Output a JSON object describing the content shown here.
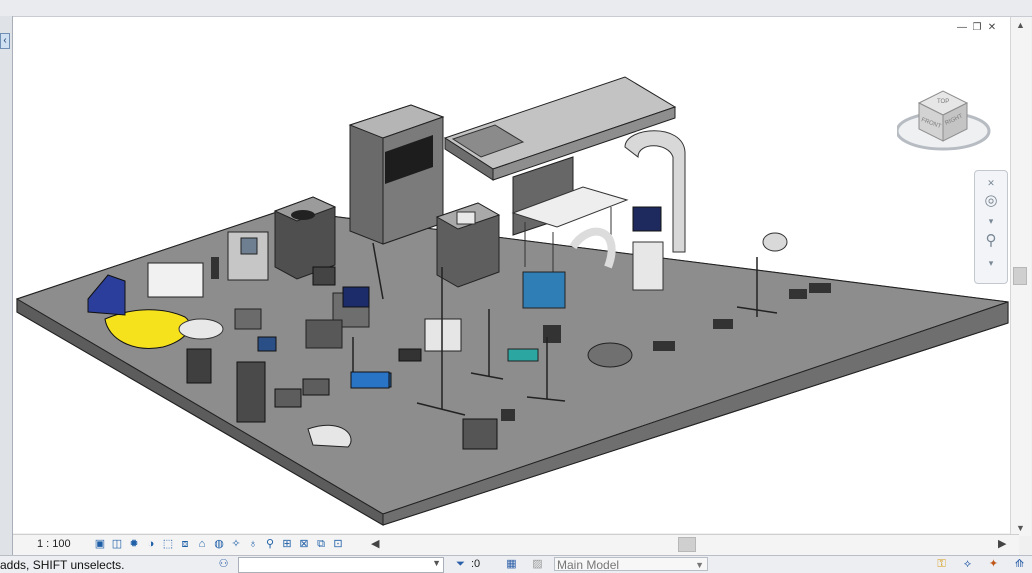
{
  "viewport": {
    "scale_label": "1 : 100",
    "viewcube": {
      "face_top": "TOP",
      "face_front": "FRONT",
      "face_right": "RIGHT"
    }
  },
  "view_controls": {
    "icons": [
      "detail-level-icon",
      "visual-style-icon",
      "sun-path-icon",
      "shadows-icon",
      "crop-view-icon",
      "show-crop-icon",
      "unlock-3d-icon",
      "temporary-hide-icon",
      "reveal-hidden-icon",
      "worksharing-display-icon",
      "analytical-model-icon",
      "highlight-displacement-icon",
      "reveal-constraints-icon",
      "temporary-view-properties-icon",
      "3d-view-lock-icon"
    ]
  },
  "status_bar": {
    "message": "adds, SHIFT unselects.",
    "filter_count": ":0",
    "model_selector": "Main Model"
  },
  "window_controls": {
    "minimize": "—",
    "restore": "❐",
    "close": "✕"
  }
}
